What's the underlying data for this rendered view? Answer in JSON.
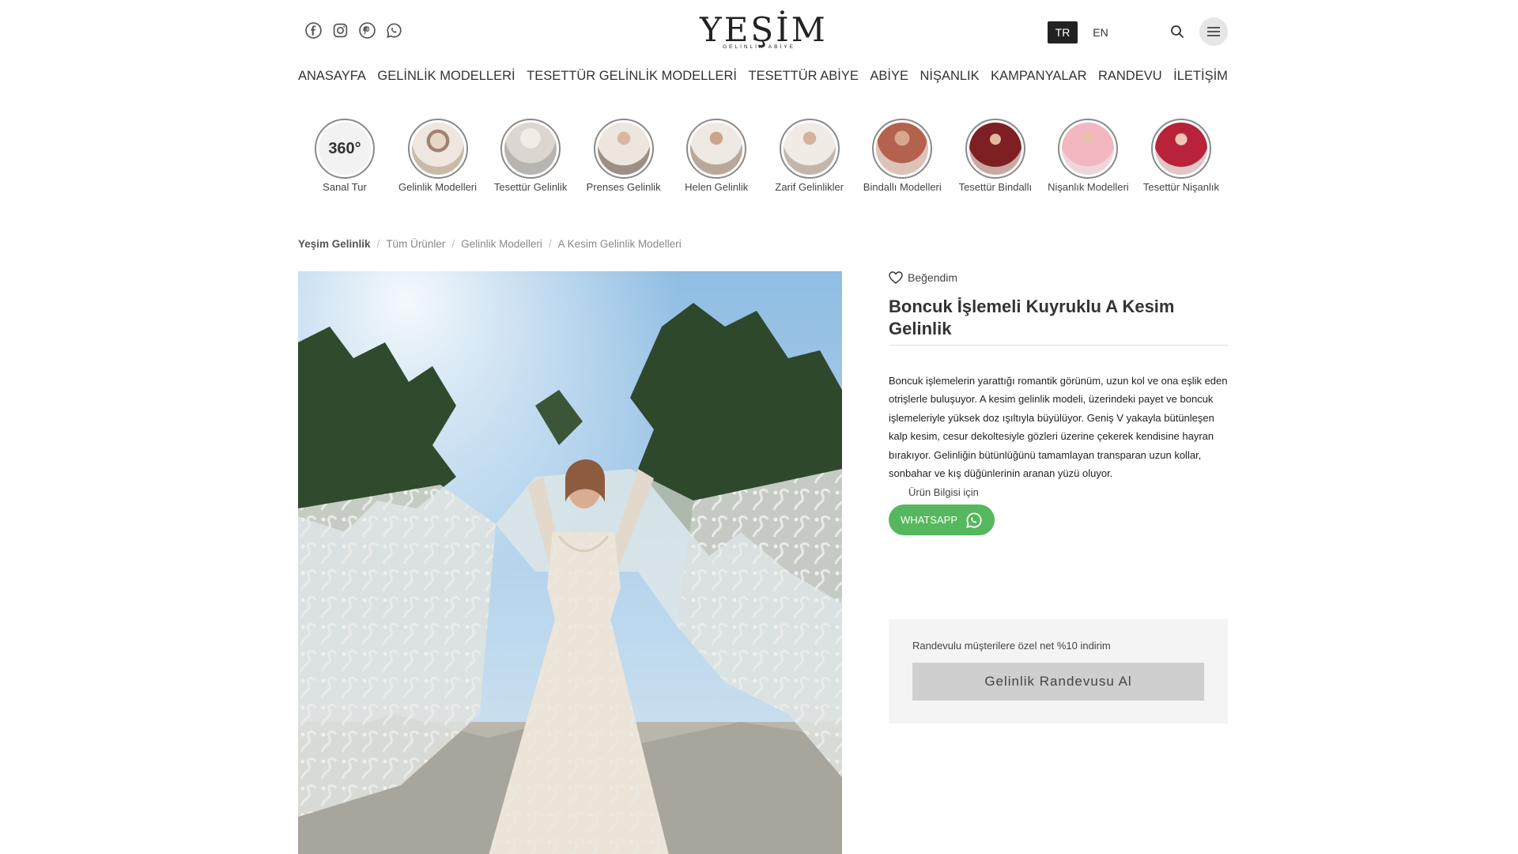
{
  "brand": {
    "logo_main": "YEŞİM",
    "logo_sub": "GELİNLİK ABİYE"
  },
  "social_icons": [
    "facebook-icon",
    "instagram-icon",
    "pinterest-icon",
    "whatsapp-icon"
  ],
  "lang": {
    "active": "TR",
    "other": "EN"
  },
  "nav": [
    "ANASAYFA",
    "GELİNLİK MODELLERİ",
    "TESETTÜR GELİNLİK MODELLERİ",
    "TESETTÜR ABİYE",
    "ABİYE",
    "NİŞANLIK",
    "KAMPANYALAR",
    "RANDEVU",
    "İLETİŞİM"
  ],
  "categories": [
    {
      "label": "Sanal Tur"
    },
    {
      "label": "Gelinlik Modelleri"
    },
    {
      "label": "Tesettür Gelinlik"
    },
    {
      "label": "Prenses Gelinlik"
    },
    {
      "label": "Helen Gelinlik"
    },
    {
      "label": "Zarif Gelinlikler"
    },
    {
      "label": "Bindallı Modelleri"
    },
    {
      "label": "Tesettür Bindallı"
    },
    {
      "label": "Nişanlık Modelleri"
    },
    {
      "label": "Tesettür Nişanlık"
    }
  ],
  "category_badge": "360°",
  "breadcrumb": [
    "Yeşim Gelinlik",
    "Tüm Ürünler",
    "Gelinlik Modelleri",
    "A Kesim Gelinlik Modelleri"
  ],
  "breadcrumb_sep": "/",
  "product": {
    "like_label": "Beğendim",
    "title": "Boncuk İşlemeli Kuyruklu A Kesim Gelinlik",
    "description": "Boncuk işlemelerin yarattığı romantik görünüm, uzun kol ve ona eşlik eden otrişlerle buluşuyor. A kesim gelinlik modeli, üzerindeki payet ve boncuk işlemeleriyle yüksek doz ışıltıyla büyülüyor. Geniş V yakayla bütünleşen kalp kesim, cesur dekoltesiyle gözleri üzerine çekerek kendisine hayran bırakıyor. Gelinliğin bütünlüğünü tamamlayan transparan uzun kollar, sonbahar ve kış düğünlerinin aranan yüzü oluyor.",
    "info_label": "Ürün Bilgisi için",
    "whatsapp_label": "WHATSAPP"
  },
  "appointment": {
    "note": "Randevulu müşterilere özel net %10 indirim",
    "button": "Gelinlik Randevusu Al"
  },
  "colors": {
    "whatsapp": "#55b85e",
    "accent": "#222222",
    "panel": "#f4f4f4",
    "button": "#cfcfcf"
  }
}
